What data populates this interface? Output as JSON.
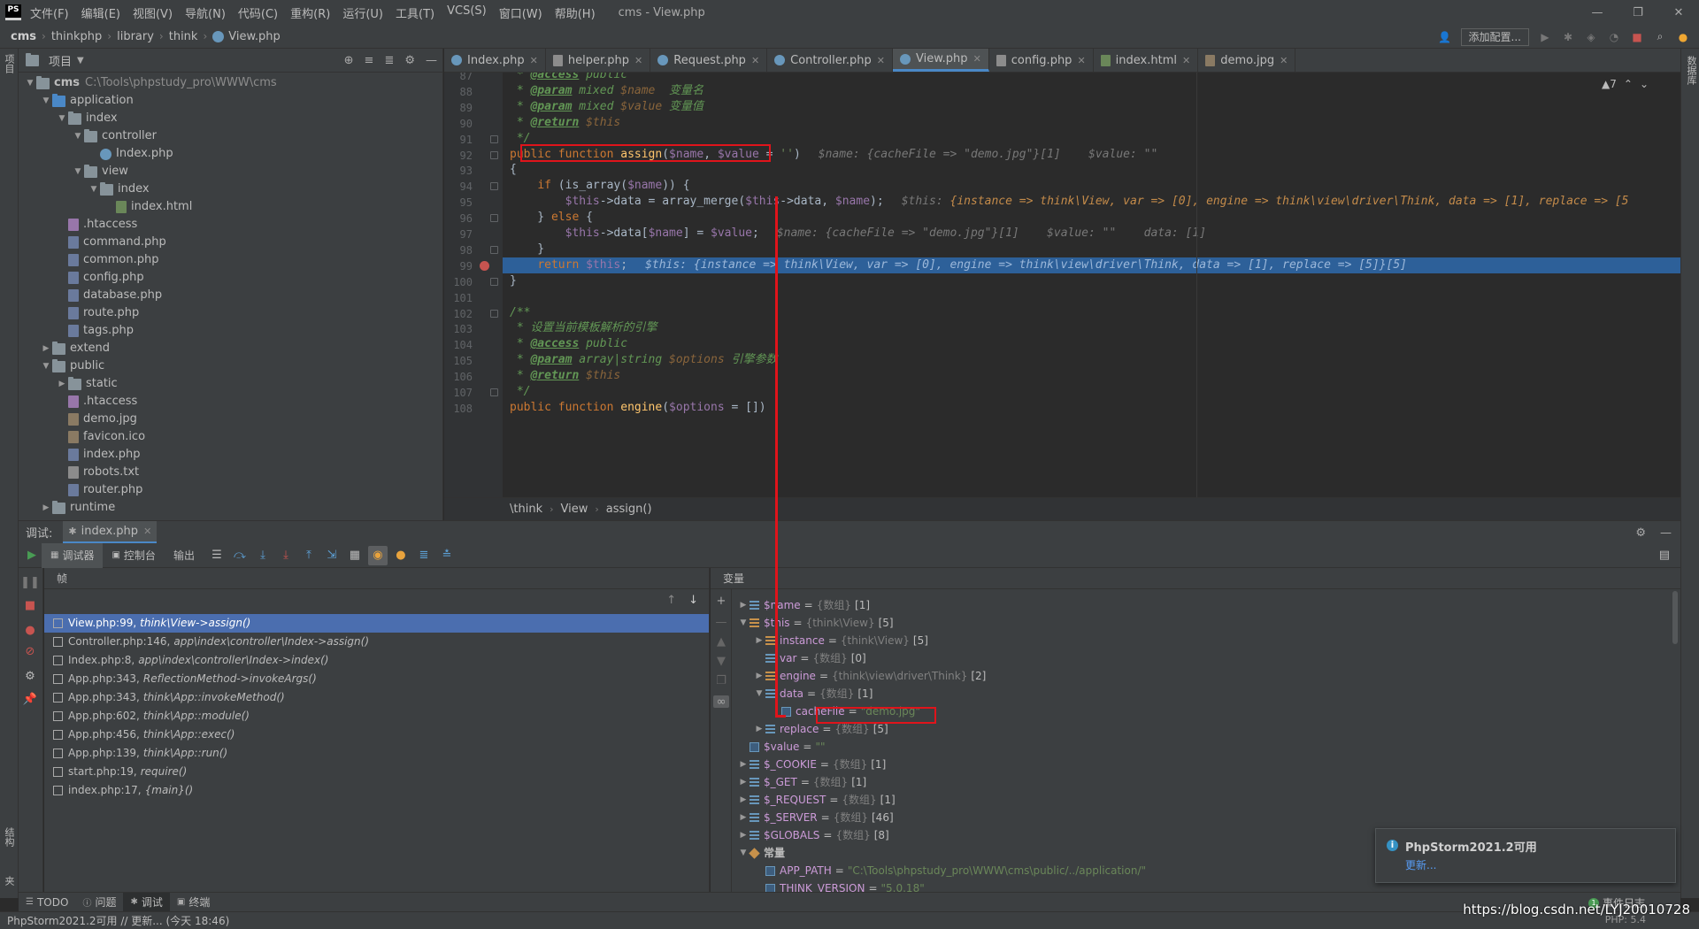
{
  "app": {
    "logo_text": "PS",
    "window_title": "cms - View.php",
    "menu": [
      "文件(F)",
      "编辑(E)",
      "视图(V)",
      "导航(N)",
      "代码(C)",
      "重构(R)",
      "运行(U)",
      "工具(T)",
      "VCS(S)",
      "窗口(W)",
      "帮助(H)"
    ]
  },
  "navbar": {
    "crumbs": [
      "cms",
      "thinkphp",
      "library",
      "think",
      "View.php"
    ],
    "add_config_label": "添加配置..."
  },
  "left_strip": {
    "project_tab": "项目",
    "structure_tab": "结构",
    "favorites_tab": "收藏夹"
  },
  "right_strip": {
    "database_tab": "数据库"
  },
  "project": {
    "title": "项目",
    "tree": [
      {
        "label": "cms",
        "path": "C:\\Tools\\phpstudy_pro\\WWW\\cms",
        "depth": 0,
        "kind": "folder",
        "expanded": true,
        "bold": true
      },
      {
        "label": "application",
        "depth": 1,
        "kind": "folder-blue",
        "expanded": true
      },
      {
        "label": "index",
        "depth": 2,
        "kind": "folder",
        "expanded": true
      },
      {
        "label": "controller",
        "depth": 3,
        "kind": "folder",
        "expanded": true
      },
      {
        "label": "Index.php",
        "depth": 4,
        "kind": "php"
      },
      {
        "label": "view",
        "depth": 3,
        "kind": "folder",
        "expanded": true
      },
      {
        "label": "index",
        "depth": 4,
        "kind": "folder",
        "expanded": true
      },
      {
        "label": "index.html",
        "depth": 5,
        "kind": "html"
      },
      {
        "label": ".htaccess",
        "depth": 2,
        "kind": "ht"
      },
      {
        "label": "command.php",
        "depth": 2,
        "kind": "php-file"
      },
      {
        "label": "common.php",
        "depth": 2,
        "kind": "php-file"
      },
      {
        "label": "config.php",
        "depth": 2,
        "kind": "php-file"
      },
      {
        "label": "database.php",
        "depth": 2,
        "kind": "php-file"
      },
      {
        "label": "route.php",
        "depth": 2,
        "kind": "php-file"
      },
      {
        "label": "tags.php",
        "depth": 2,
        "kind": "php-file"
      },
      {
        "label": "extend",
        "depth": 1,
        "kind": "folder",
        "expanded": false
      },
      {
        "label": "public",
        "depth": 1,
        "kind": "folder",
        "expanded": true
      },
      {
        "label": "static",
        "depth": 2,
        "kind": "folder",
        "expanded": false
      },
      {
        "label": ".htaccess",
        "depth": 2,
        "kind": "ht"
      },
      {
        "label": "demo.jpg",
        "depth": 2,
        "kind": "img"
      },
      {
        "label": "favicon.ico",
        "depth": 2,
        "kind": "img"
      },
      {
        "label": "index.php",
        "depth": 2,
        "kind": "php-file"
      },
      {
        "label": "robots.txt",
        "depth": 2,
        "kind": "txt"
      },
      {
        "label": "router.php",
        "depth": 2,
        "kind": "php-file"
      },
      {
        "label": "runtime",
        "depth": 1,
        "kind": "folder",
        "expanded": false
      }
    ]
  },
  "editor_tabs": [
    {
      "label": "Index.php",
      "icon": "php",
      "active": false
    },
    {
      "label": "helper.php",
      "icon": "file",
      "active": false
    },
    {
      "label": "Request.php",
      "icon": "php",
      "active": false
    },
    {
      "label": "Controller.php",
      "icon": "php",
      "active": false
    },
    {
      "label": "View.php",
      "icon": "php",
      "active": true
    },
    {
      "label": "config.php",
      "icon": "file",
      "active": false
    },
    {
      "label": "index.html",
      "icon": "html",
      "active": false
    },
    {
      "label": "demo.jpg",
      "icon": "img",
      "active": false
    }
  ],
  "editor": {
    "inspection_count": "▲7",
    "line_numbers": [
      "87",
      "88",
      "89",
      "90",
      "91",
      "92",
      "93",
      "94",
      "95",
      "96",
      "97",
      "98",
      "99",
      "100",
      "101",
      "102",
      "103",
      "104",
      "105",
      "106",
      "107",
      "108"
    ],
    "lines": [
      " * @access public",
      " * @param mixed $name  变量名",
      " * @param mixed $value 变量值",
      " * @return $this",
      " */",
      "public function assign($name, $value = '')",
      "{",
      "    if (is_array($name)) {",
      "        $this->data = array_merge($this->data, $name);",
      "    } else {",
      "        $this->data[$name] = $value;",
      "    }",
      "    return $this;",
      "}",
      "",
      "/**",
      " * 设置当前模板解析的引擎",
      " * @access public",
      " * @param array|string $options 引擎参数",
      " * @return $this",
      " */",
      "public function engine($options = [])"
    ],
    "inline_92": "$name: {cacheFile => \"demo.jpg\"}[1]    $value: \"\"",
    "inline_95_label": "$this: ",
    "inline_95_value": "{instance => think\\View, var => [0], engine => think\\view\\driver\\Think, data => [1], replace => [5",
    "inline_97": "$name: {cacheFile => \"demo.jpg\"}[1]    $value: \"\"    data: [1]",
    "inline_99": "$this: {instance => think\\View, var => [0], engine => think\\view\\driver\\Think, data => [1], replace => [5]}[5]",
    "breadcrumbs": [
      "\\think",
      "View",
      "assign()"
    ]
  },
  "debug": {
    "label": "调试:",
    "session": "index.php",
    "tabs": [
      "调试器",
      "控制台",
      "输出"
    ],
    "frames_header": "帧",
    "vars_header": "变量",
    "frames": [
      {
        "file": "View.php:99,",
        "fn": "think\\View->assign()",
        "selected": true
      },
      {
        "file": "Controller.php:146,",
        "fn": "app\\index\\controller\\Index->assign()",
        "selected": false
      },
      {
        "file": "Index.php:8,",
        "fn": "app\\index\\controller\\Index->index()",
        "selected": false
      },
      {
        "file": "App.php:343,",
        "fn": "ReflectionMethod->invokeArgs()",
        "selected": false
      },
      {
        "file": "App.php:343,",
        "fn": "think\\App::invokeMethod()",
        "selected": false
      },
      {
        "file": "App.php:602,",
        "fn": "think\\App::module()",
        "selected": false
      },
      {
        "file": "App.php:456,",
        "fn": "think\\App::exec()",
        "selected": false
      },
      {
        "file": "App.php:139,",
        "fn": "think\\App::run()",
        "selected": false
      },
      {
        "file": "start.php:19,",
        "fn": "require()",
        "selected": false
      },
      {
        "file": "index.php:17,",
        "fn": "{main}()",
        "selected": false
      }
    ],
    "variables": [
      {
        "name": "$name",
        "type": "{数组}",
        "count": "[1]",
        "depth": 0,
        "arrow": "collapsed",
        "icon": "arr"
      },
      {
        "name": "$this",
        "type": "{think\\View}",
        "count": "[5]",
        "depth": 0,
        "arrow": "expanded",
        "icon": "obj"
      },
      {
        "name": "instance",
        "type": "{think\\View}",
        "count": "[5]",
        "depth": 1,
        "arrow": "collapsed",
        "icon": "obj"
      },
      {
        "name": "var",
        "type": "{数组}",
        "count": "[0]",
        "depth": 1,
        "arrow": "none",
        "icon": "arr"
      },
      {
        "name": "engine",
        "type": "{think\\view\\driver\\Think}",
        "count": "[2]",
        "depth": 1,
        "arrow": "collapsed",
        "icon": "obj"
      },
      {
        "name": "data",
        "type": "{数组}",
        "count": "[1]",
        "depth": 1,
        "arrow": "expanded",
        "icon": "arr"
      },
      {
        "name": "cacheFile",
        "str": "\"demo.jpg\"",
        "depth": 2,
        "arrow": "none",
        "icon": "prim"
      },
      {
        "name": "replace",
        "type": "{数组}",
        "count": "[5]",
        "depth": 1,
        "arrow": "collapsed",
        "icon": "arr"
      },
      {
        "name": "$value",
        "str": "\"\"",
        "depth": 0,
        "arrow": "none",
        "icon": "prim"
      },
      {
        "name": "$_COOKIE",
        "type": "{数组}",
        "count": "[1]",
        "depth": 0,
        "arrow": "collapsed",
        "icon": "arr"
      },
      {
        "name": "$_GET",
        "type": "{数组}",
        "count": "[1]",
        "depth": 0,
        "arrow": "collapsed",
        "icon": "arr"
      },
      {
        "name": "$_REQUEST",
        "type": "{数组}",
        "count": "[1]",
        "depth": 0,
        "arrow": "collapsed",
        "icon": "arr"
      },
      {
        "name": "$_SERVER",
        "type": "{数组}",
        "count": "[46]",
        "depth": 0,
        "arrow": "collapsed",
        "icon": "arr"
      },
      {
        "name": "$GLOBALS",
        "type": "{数组}",
        "count": "[8]",
        "depth": 0,
        "arrow": "collapsed",
        "icon": "arr"
      },
      {
        "name": "常量",
        "depth": 0,
        "arrow": "expanded",
        "icon": "const",
        "group": true
      },
      {
        "name": "APP_PATH",
        "str": "\"C:\\Tools\\phpstudy_pro\\WWW\\cms\\public/../application/\"",
        "depth": 1,
        "arrow": "none",
        "icon": "prim"
      },
      {
        "name": "THINK_VERSION",
        "str": "\"5.0.18\"",
        "depth": 1,
        "arrow": "none",
        "icon": "prim"
      }
    ]
  },
  "notification": {
    "title": "PhpStorm2021.2可用",
    "link": "更新..."
  },
  "tool_tabs": [
    "TODO",
    "问题",
    "调试",
    "终端"
  ],
  "event_log": "事件日志",
  "status": {
    "text": "PhpStorm2021.2可用 // 更新... (今天 18:46)",
    "php_version": "PHP: 5.4"
  },
  "watermark": "https://blog.csdn.net/LYJ20010728",
  "colors": {
    "accent": "#4a88c7",
    "annotation": "#e0141b",
    "exec_line": "#2d6099",
    "selected_frame": "#4b6eaf"
  }
}
